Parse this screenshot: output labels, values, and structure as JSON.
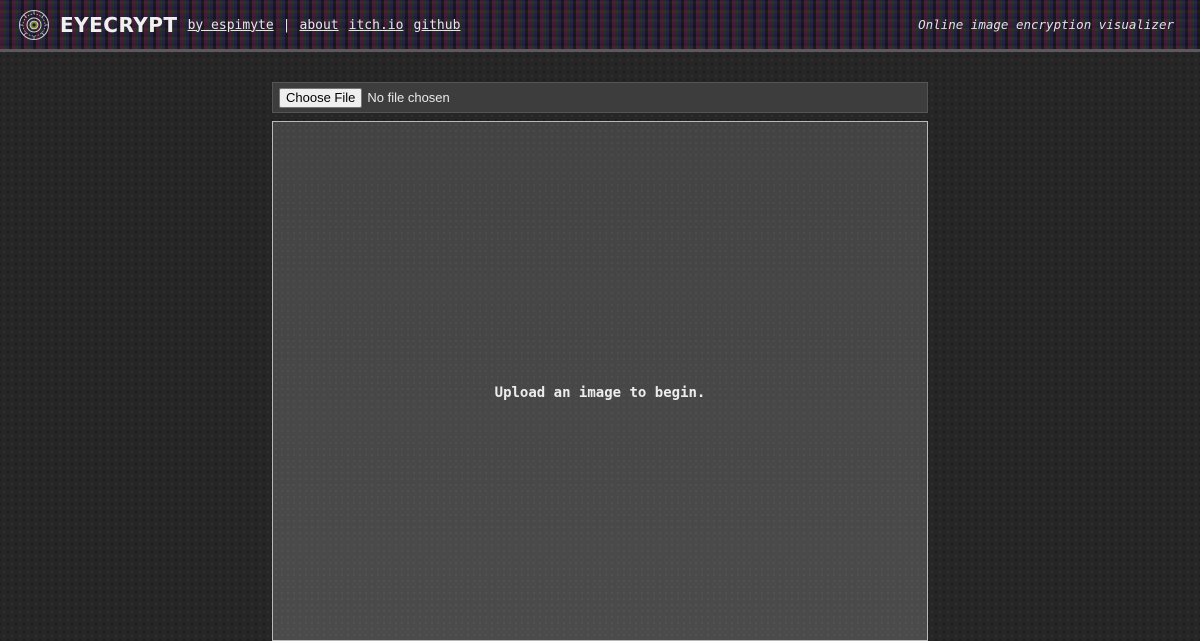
{
  "header": {
    "logo_text": "EYECRYPT",
    "author_link": "by espimyte",
    "separator": "|",
    "nav": {
      "about": "about",
      "itch": "itch.io",
      "github": "github"
    },
    "tagline": "Online image encryption visualizer"
  },
  "file_input": {
    "button_label": "Choose File",
    "status": "No file chosen"
  },
  "canvas": {
    "placeholder": "Upload an image to begin."
  },
  "icons": {
    "logo": "eye-mandala-icon"
  },
  "colors": {
    "background": "#262626",
    "panel": "#474747",
    "text": "#e8e8e8"
  }
}
